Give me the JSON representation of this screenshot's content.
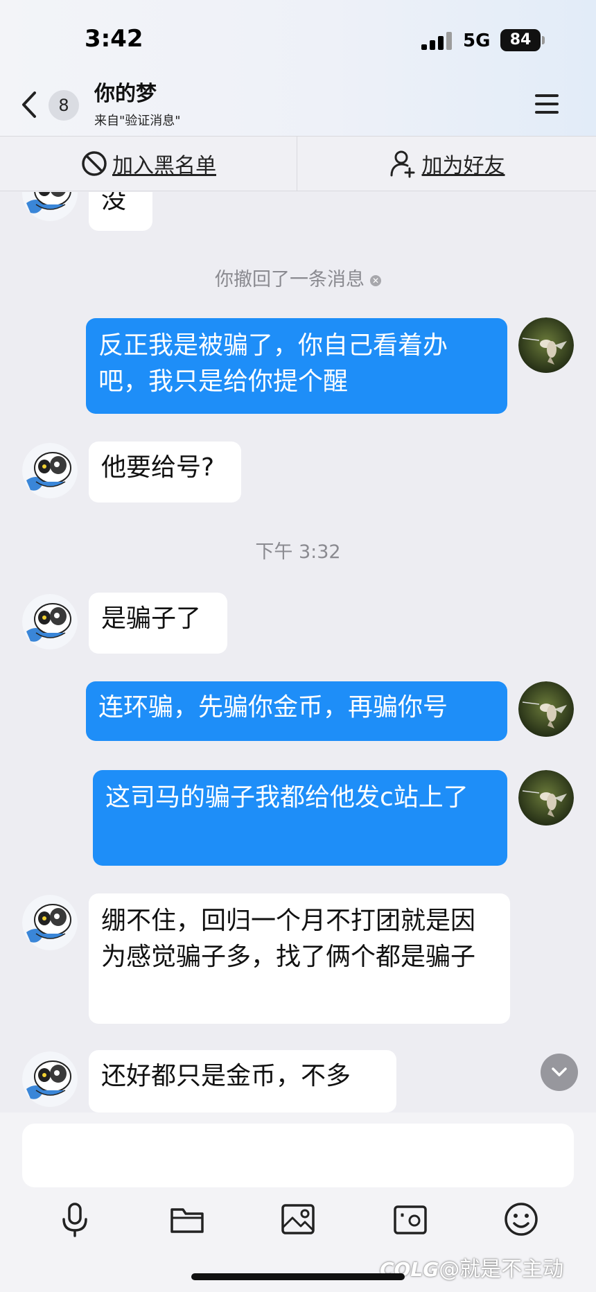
{
  "status_bar": {
    "time": "3:42",
    "network": "5G",
    "battery": "84"
  },
  "header": {
    "unread_count": "8",
    "title": "你的梦",
    "subtitle": "来自\"验证消息\""
  },
  "actions": {
    "blacklist_label": "加入黑名单",
    "add_friend_label": "加为好友"
  },
  "messages": [
    {
      "side": "in",
      "text": "没"
    },
    {
      "side": "in",
      "text": "他要给号?"
    },
    {
      "side": "in",
      "text": "是骗子了"
    },
    {
      "side": "in",
      "text": "绷不住，回归一个月不打团就是因为感觉骗子多，找了俩个都是骗子"
    },
    {
      "side": "in",
      "text": "还好都只是金币，不多"
    },
    {
      "side": "out",
      "text": "反正我是被骗了，你自己看着办吧，我只是给你提个醒"
    },
    {
      "side": "out",
      "text": "连环骗，先骗你金币，再骗你号"
    },
    {
      "side": "out",
      "text": "这司马的骗子我都给他发c站上了"
    }
  ],
  "system": {
    "recall_notice": "你撤回了一条消息",
    "timestamp": "下午 3:32"
  },
  "watermark": "@就是不主动",
  "watermark_logo": "COLG",
  "colors": {
    "outgoing_bubble": "#1E8EF8",
    "incoming_bubble": "#FFFFFF",
    "background": "#EDEDF2"
  },
  "icons": {
    "back": "chevron-left-icon",
    "menu": "hamburger-menu-icon",
    "blacklist": "block-icon",
    "add_friend": "person-add-icon",
    "toolbar": [
      "microphone-icon",
      "folder-icon",
      "image-icon",
      "camera-icon",
      "emoji-icon"
    ]
  }
}
